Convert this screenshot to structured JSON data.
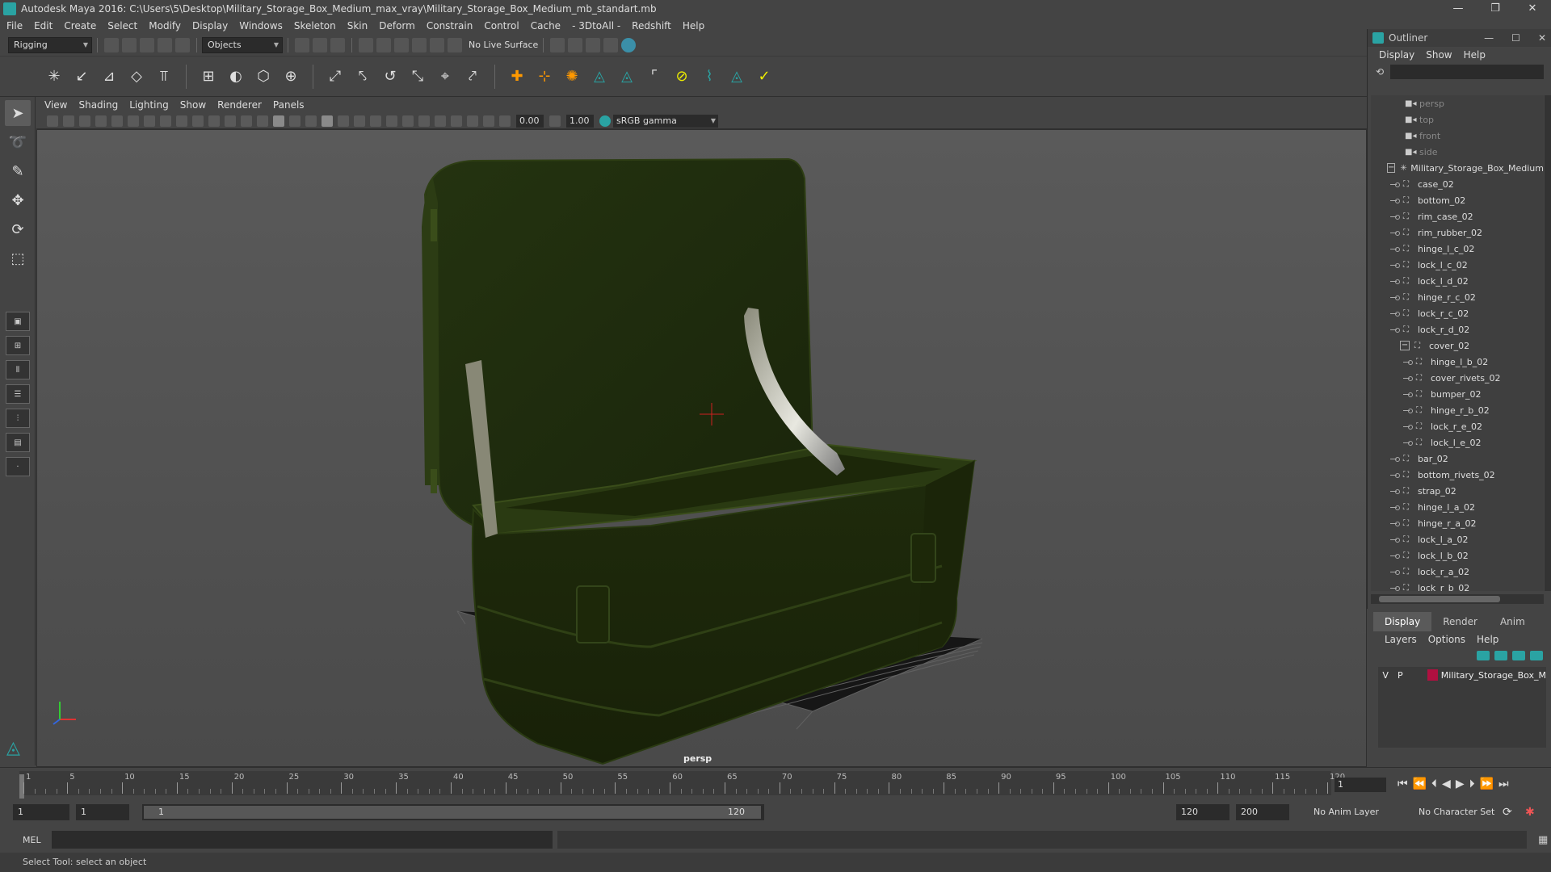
{
  "window": {
    "title": "Autodesk Maya 2016: C:\\Users\\5\\Desktop\\Military_Storage_Box_Medium_max_vray\\Military_Storage_Box_Medium_mb_standart.mb",
    "minimize": "—",
    "maximize": "❐",
    "close": "✕"
  },
  "menubar": [
    "File",
    "Edit",
    "Create",
    "Select",
    "Modify",
    "Display",
    "Windows",
    "Skeleton",
    "Skin",
    "Deform",
    "Constrain",
    "Control",
    "Cache",
    "- 3DtoAll -",
    "Redshift",
    "Help"
  ],
  "statusline": {
    "mode": "Rigging",
    "selection_mode": "Objects",
    "live_surface": "No Live Surface"
  },
  "viewport": {
    "menu": [
      "View",
      "Shading",
      "Lighting",
      "Show",
      "Renderer",
      "Panels"
    ],
    "exposure": "0.00",
    "gamma_value": "1.00",
    "color_space": "sRGB gamma",
    "camera": "persp"
  },
  "outliner": {
    "title": "Outliner",
    "menu": [
      "Display",
      "Show",
      "Help"
    ],
    "cameras": [
      "persp",
      "top",
      "front",
      "side"
    ],
    "root": "Military_Storage_Box_Medium",
    "children": [
      "case_02",
      "bottom_02",
      "rim_case_02",
      "rim_rubber_02",
      "hinge_l_c_02",
      "lock_l_c_02",
      "lock_l_d_02",
      "hinge_r_c_02",
      "lock_r_c_02",
      "lock_r_d_02"
    ],
    "group": "cover_02",
    "group_children": [
      "hinge_l_b_02",
      "cover_rivets_02",
      "bumper_02",
      "hinge_r_b_02",
      "lock_r_e_02",
      "lock_l_e_02"
    ],
    "tail_children": [
      "bar_02",
      "bottom_rivets_02",
      "strap_02",
      "hinge_l_a_02",
      "hinge_r_a_02",
      "lock_l_a_02",
      "lock_l_b_02",
      "lock_r_a_02",
      "lock_r_b_02"
    ]
  },
  "layers": {
    "tabs": [
      "Display",
      "Render",
      "Anim"
    ],
    "active_tab": "Display",
    "menu": [
      "Layers",
      "Options",
      "Help"
    ],
    "rows": [
      {
        "v": "V",
        "p": "P",
        "name": "Military_Storage_Box_M",
        "color": "#b01040"
      }
    ]
  },
  "timeline": {
    "labels": [
      "1",
      "5",
      "10",
      "15",
      "20",
      "25",
      "30",
      "35",
      "40",
      "45",
      "50",
      "55",
      "60",
      "65",
      "70",
      "75",
      "80",
      "85",
      "90",
      "95",
      "100",
      "105",
      "110",
      "115",
      "120"
    ],
    "current_frame": "1"
  },
  "range": {
    "start": "1",
    "inner_start": "1",
    "bar_start": "1",
    "bar_end": "120",
    "end": "120",
    "max": "200",
    "anim_layer": "No Anim Layer",
    "char_set": "No Character Set"
  },
  "cmdline": {
    "label": "MEL"
  },
  "helpline": {
    "text": "Select Tool: select an object"
  },
  "colors": {
    "accent": "#2aa3a3",
    "layer_swatch": "#b01040",
    "model": "#1e2a0c"
  }
}
